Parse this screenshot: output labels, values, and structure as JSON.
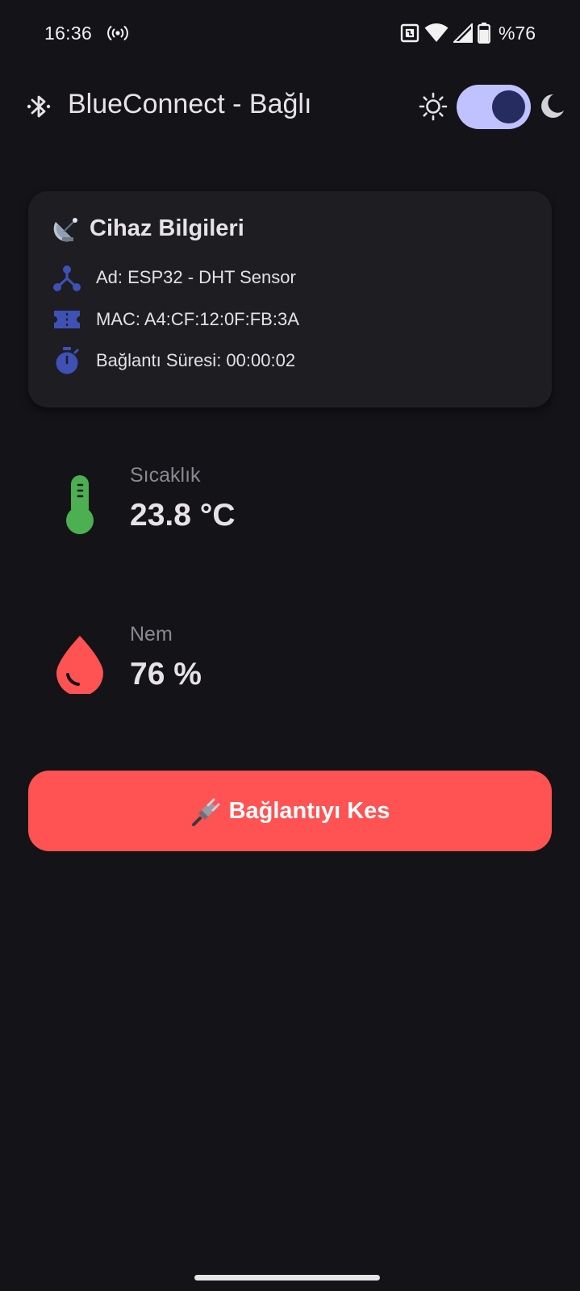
{
  "status_bar": {
    "time": "16:36",
    "battery_text": "%76",
    "icons": [
      "hotspot-icon",
      "nfc-icon",
      "wifi-icon",
      "cell-signal-icon",
      "battery-icon"
    ]
  },
  "app_bar": {
    "title": "BlueConnect - Bağlı",
    "icons": [
      "bluetooth-icon",
      "sun-icon",
      "moon-icon"
    ],
    "dark_mode": true
  },
  "device_card": {
    "title": "Cihaz Bilgileri",
    "title_icon": "satellite-antenna-icon",
    "rows": [
      {
        "icon": "device-hub-icon",
        "text": "Ad: ESP32 - DHT Sensor"
      },
      {
        "icon": "mac-ticket-icon",
        "text": "MAC: A4:CF:12:0F:FB:3A"
      },
      {
        "icon": "timer-icon",
        "text": "Bağlantı Süresi: 00:00:02"
      }
    ]
  },
  "sensors": [
    {
      "icon": "thermometer-icon",
      "label": "Sıcaklık",
      "value": "23.8 °C",
      "color": "#4CAF50"
    },
    {
      "icon": "water-drop-icon",
      "label": "Nem",
      "value": "76 %",
      "color": "#FF5252"
    }
  ],
  "disconnect_button": {
    "label": "Bağlantıyı Kes",
    "icon": "electric-plug-icon",
    "color": "#FF5252"
  },
  "colors": {
    "background": "#131318",
    "card": "#1D1D22",
    "accent": "#BFC2FF",
    "icon_blue": "#3F51B5"
  }
}
